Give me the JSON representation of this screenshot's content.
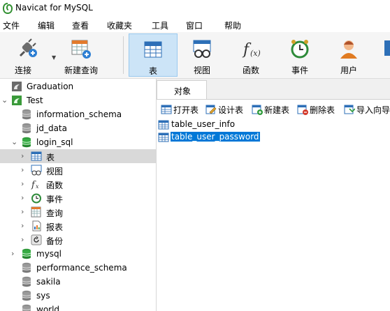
{
  "window": {
    "title": "Navicat for MySQL"
  },
  "menu": [
    "文件",
    "编辑",
    "查看",
    "收藏夹",
    "工具",
    "窗口",
    "帮助"
  ],
  "toolbar": {
    "connect": "连接",
    "new_query": "新建查询",
    "table": "表",
    "view": "视图",
    "function": "函数",
    "event": "事件",
    "user": "用户"
  },
  "tree": [
    {
      "label": "Graduation",
      "icon": "connection-icon",
      "expanded": false
    },
    {
      "label": "Test",
      "icon": "connection-icon",
      "expanded": true
    },
    {
      "label": "information_schema",
      "icon": "database-icon"
    },
    {
      "label": "jd_data",
      "icon": "database-icon"
    },
    {
      "label": "login_sql",
      "icon": "database-icon",
      "expanded": true
    },
    {
      "label": "表",
      "icon": "table-icon",
      "selected": true
    },
    {
      "label": "视图",
      "icon": "view-icon"
    },
    {
      "label": "函数",
      "icon": "function-icon"
    },
    {
      "label": "事件",
      "icon": "event-icon"
    },
    {
      "label": "查询",
      "icon": "query-icon"
    },
    {
      "label": "报表",
      "icon": "report-icon"
    },
    {
      "label": "备份",
      "icon": "backup-icon"
    },
    {
      "label": "mysql",
      "icon": "database-icon"
    },
    {
      "label": "performance_schema",
      "icon": "database-icon"
    },
    {
      "label": "sakila",
      "icon": "database-icon"
    },
    {
      "label": "sys",
      "icon": "database-icon"
    },
    {
      "label": "world",
      "icon": "database-icon"
    }
  ],
  "objects_tab": "对象",
  "object_toolbar": {
    "open": "打开表",
    "design": "设计表",
    "new": "新建表",
    "delete": "删除表",
    "import": "导入向导"
  },
  "objects": [
    {
      "name": "table_user_info",
      "selected": false
    },
    {
      "name": "table_user_password",
      "selected": true
    }
  ],
  "colors": {
    "accent": "#0078d7",
    "active_toolbar": "#cce4f7",
    "selected_tree": "#d9d9d9"
  }
}
